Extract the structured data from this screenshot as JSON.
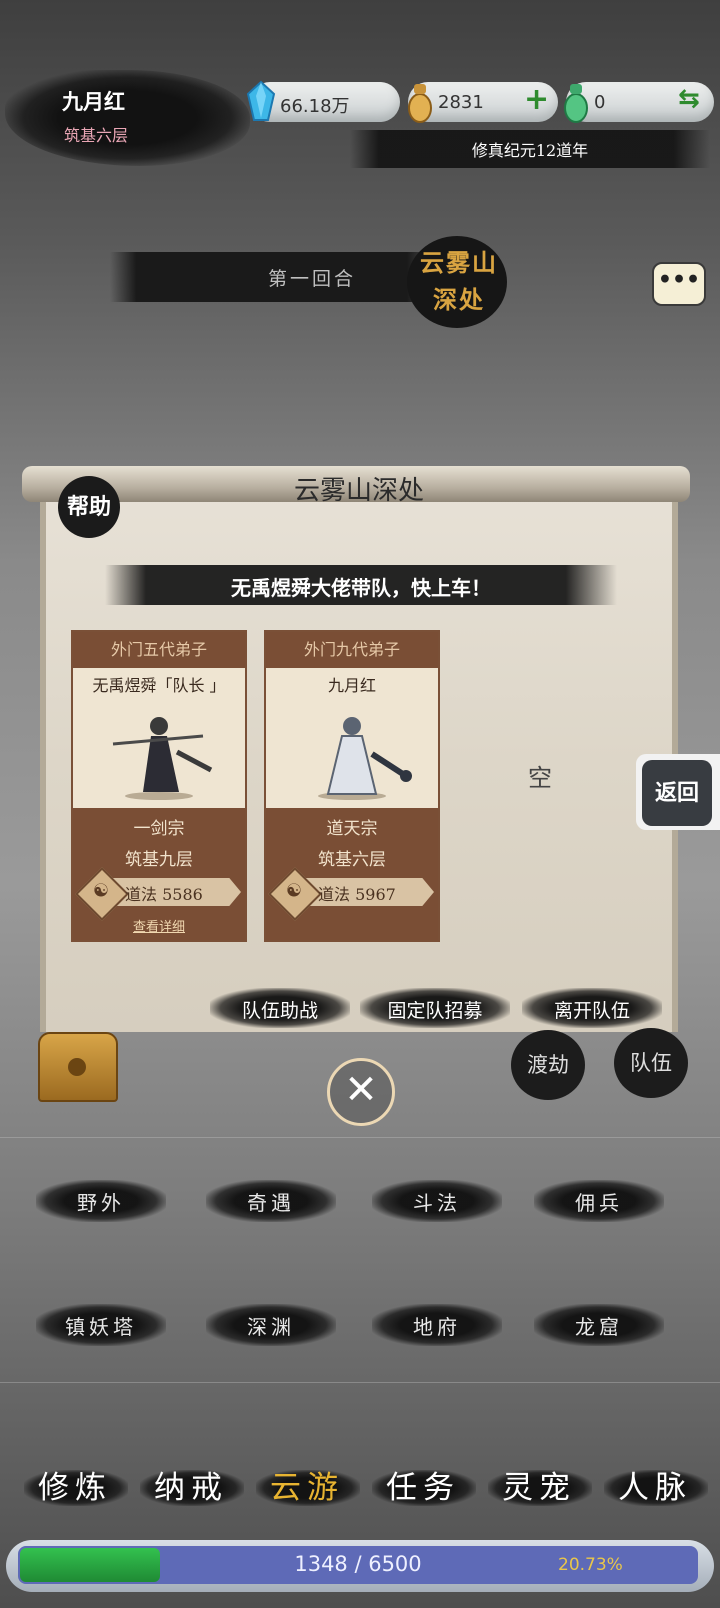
{
  "player": {
    "name": "九月红",
    "realm": "筑基六层"
  },
  "currencies": {
    "spirit_stone": "66.18万",
    "gold": "2831",
    "jade": "0",
    "add_symbol": "+",
    "exchange_symbol": "⇆"
  },
  "era": "修真纪元12道年",
  "round": "第一回合",
  "location_badge": "云雾山深处",
  "chat_symbol": "•••",
  "panel": {
    "title": "云雾山深处",
    "help_label": "帮助",
    "banner": "无禹煜舜大佬带队，快上车！",
    "members": [
      {
        "rank": "外门五代弟子",
        "name": "无禹煜舜「队长 」",
        "sect": "一剑宗",
        "realm": "筑基九层",
        "power": "道法 5586",
        "detail": "查看详细"
      },
      {
        "rank": "外门九代弟子",
        "name": "九月红",
        "sect": "道天宗",
        "realm": "筑基六层",
        "power": "道法 5967"
      }
    ],
    "empty_label": "空",
    "actions": {
      "assist": "队伍助战",
      "recruit": "固定队招募",
      "leave": "离开队伍"
    }
  },
  "back_label": "返回",
  "close_symbol": "✕",
  "side_buttons": {
    "tribulation": "渡劫",
    "team": "队伍"
  },
  "menu": {
    "row1": [
      "野外",
      "奇遇",
      "斗法",
      "佣兵"
    ],
    "row2": [
      "镇妖塔",
      "深渊",
      "地府",
      "龙窟"
    ]
  },
  "nav": [
    "修炼",
    "纳戒",
    "云游",
    "任务",
    "灵宠",
    "人脉"
  ],
  "nav_active_index": 2,
  "xp": {
    "text": "1348 / 6500",
    "percent": "20.73%",
    "fraction": 0.2073
  },
  "colors": {
    "accent": "#e8b431",
    "realm_pink": "#e9a6b5",
    "card_brown": "#7a4e35",
    "xp_green": "#2aa644",
    "xp_blue": "#5e6ab7"
  }
}
